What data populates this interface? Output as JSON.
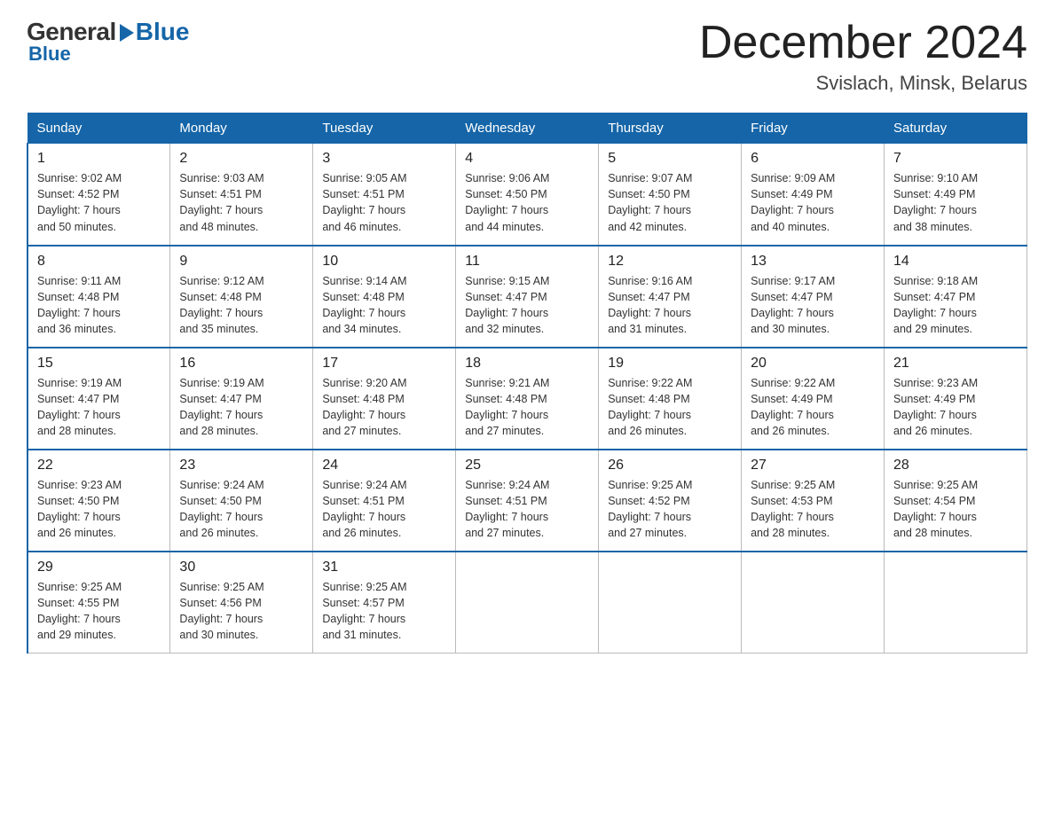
{
  "logo": {
    "general": "General",
    "blue": "Blue"
  },
  "title": "December 2024",
  "location": "Svislach, Minsk, Belarus",
  "days_of_week": [
    "Sunday",
    "Monday",
    "Tuesday",
    "Wednesday",
    "Thursday",
    "Friday",
    "Saturday"
  ],
  "weeks": [
    [
      {
        "day": "1",
        "info": "Sunrise: 9:02 AM\nSunset: 4:52 PM\nDaylight: 7 hours\nand 50 minutes."
      },
      {
        "day": "2",
        "info": "Sunrise: 9:03 AM\nSunset: 4:51 PM\nDaylight: 7 hours\nand 48 minutes."
      },
      {
        "day": "3",
        "info": "Sunrise: 9:05 AM\nSunset: 4:51 PM\nDaylight: 7 hours\nand 46 minutes."
      },
      {
        "day": "4",
        "info": "Sunrise: 9:06 AM\nSunset: 4:50 PM\nDaylight: 7 hours\nand 44 minutes."
      },
      {
        "day": "5",
        "info": "Sunrise: 9:07 AM\nSunset: 4:50 PM\nDaylight: 7 hours\nand 42 minutes."
      },
      {
        "day": "6",
        "info": "Sunrise: 9:09 AM\nSunset: 4:49 PM\nDaylight: 7 hours\nand 40 minutes."
      },
      {
        "day": "7",
        "info": "Sunrise: 9:10 AM\nSunset: 4:49 PM\nDaylight: 7 hours\nand 38 minutes."
      }
    ],
    [
      {
        "day": "8",
        "info": "Sunrise: 9:11 AM\nSunset: 4:48 PM\nDaylight: 7 hours\nand 36 minutes."
      },
      {
        "day": "9",
        "info": "Sunrise: 9:12 AM\nSunset: 4:48 PM\nDaylight: 7 hours\nand 35 minutes."
      },
      {
        "day": "10",
        "info": "Sunrise: 9:14 AM\nSunset: 4:48 PM\nDaylight: 7 hours\nand 34 minutes."
      },
      {
        "day": "11",
        "info": "Sunrise: 9:15 AM\nSunset: 4:47 PM\nDaylight: 7 hours\nand 32 minutes."
      },
      {
        "day": "12",
        "info": "Sunrise: 9:16 AM\nSunset: 4:47 PM\nDaylight: 7 hours\nand 31 minutes."
      },
      {
        "day": "13",
        "info": "Sunrise: 9:17 AM\nSunset: 4:47 PM\nDaylight: 7 hours\nand 30 minutes."
      },
      {
        "day": "14",
        "info": "Sunrise: 9:18 AM\nSunset: 4:47 PM\nDaylight: 7 hours\nand 29 minutes."
      }
    ],
    [
      {
        "day": "15",
        "info": "Sunrise: 9:19 AM\nSunset: 4:47 PM\nDaylight: 7 hours\nand 28 minutes."
      },
      {
        "day": "16",
        "info": "Sunrise: 9:19 AM\nSunset: 4:47 PM\nDaylight: 7 hours\nand 28 minutes."
      },
      {
        "day": "17",
        "info": "Sunrise: 9:20 AM\nSunset: 4:48 PM\nDaylight: 7 hours\nand 27 minutes."
      },
      {
        "day": "18",
        "info": "Sunrise: 9:21 AM\nSunset: 4:48 PM\nDaylight: 7 hours\nand 27 minutes."
      },
      {
        "day": "19",
        "info": "Sunrise: 9:22 AM\nSunset: 4:48 PM\nDaylight: 7 hours\nand 26 minutes."
      },
      {
        "day": "20",
        "info": "Sunrise: 9:22 AM\nSunset: 4:49 PM\nDaylight: 7 hours\nand 26 minutes."
      },
      {
        "day": "21",
        "info": "Sunrise: 9:23 AM\nSunset: 4:49 PM\nDaylight: 7 hours\nand 26 minutes."
      }
    ],
    [
      {
        "day": "22",
        "info": "Sunrise: 9:23 AM\nSunset: 4:50 PM\nDaylight: 7 hours\nand 26 minutes."
      },
      {
        "day": "23",
        "info": "Sunrise: 9:24 AM\nSunset: 4:50 PM\nDaylight: 7 hours\nand 26 minutes."
      },
      {
        "day": "24",
        "info": "Sunrise: 9:24 AM\nSunset: 4:51 PM\nDaylight: 7 hours\nand 26 minutes."
      },
      {
        "day": "25",
        "info": "Sunrise: 9:24 AM\nSunset: 4:51 PM\nDaylight: 7 hours\nand 27 minutes."
      },
      {
        "day": "26",
        "info": "Sunrise: 9:25 AM\nSunset: 4:52 PM\nDaylight: 7 hours\nand 27 minutes."
      },
      {
        "day": "27",
        "info": "Sunrise: 9:25 AM\nSunset: 4:53 PM\nDaylight: 7 hours\nand 28 minutes."
      },
      {
        "day": "28",
        "info": "Sunrise: 9:25 AM\nSunset: 4:54 PM\nDaylight: 7 hours\nand 28 minutes."
      }
    ],
    [
      {
        "day": "29",
        "info": "Sunrise: 9:25 AM\nSunset: 4:55 PM\nDaylight: 7 hours\nand 29 minutes."
      },
      {
        "day": "30",
        "info": "Sunrise: 9:25 AM\nSunset: 4:56 PM\nDaylight: 7 hours\nand 30 minutes."
      },
      {
        "day": "31",
        "info": "Sunrise: 9:25 AM\nSunset: 4:57 PM\nDaylight: 7 hours\nand 31 minutes."
      },
      null,
      null,
      null,
      null
    ]
  ]
}
